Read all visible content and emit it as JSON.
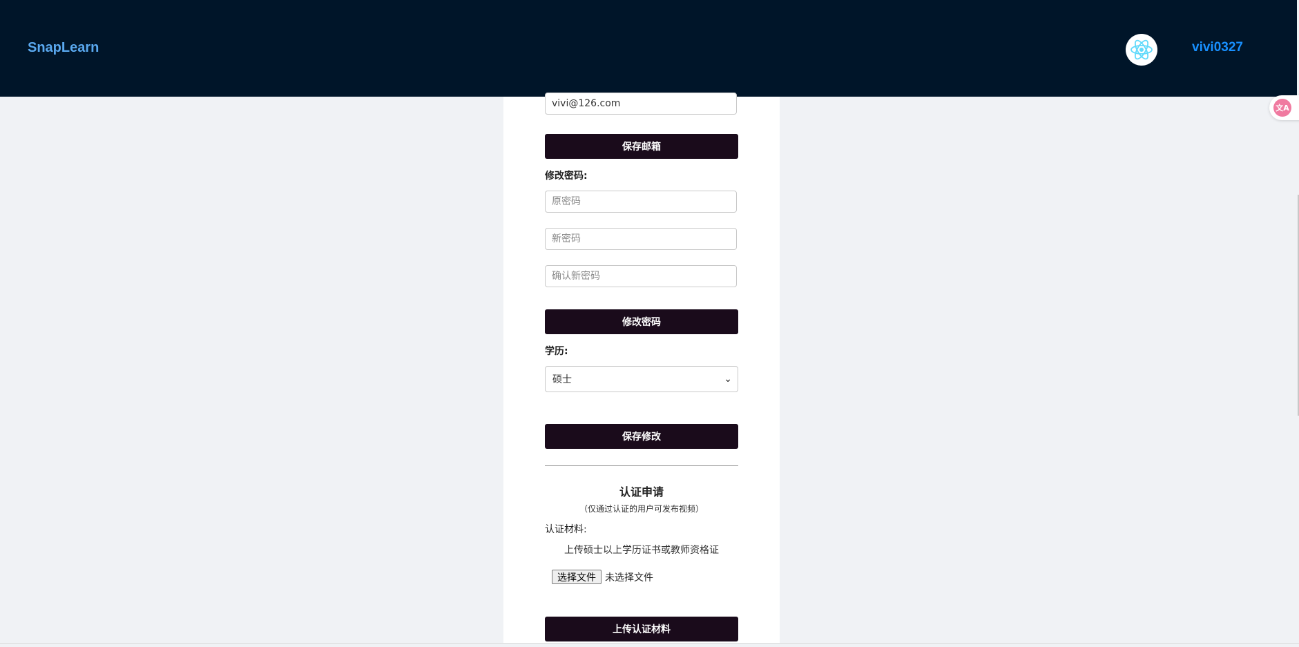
{
  "header": {
    "brand": "SnapLearn",
    "username": "vivi0327",
    "avatar_icon": "react-atom-icon"
  },
  "form": {
    "email_value": "vivi@126.com",
    "save_email_label": "保存邮箱",
    "password_section_label": "修改密码:",
    "old_password_placeholder": "原密码",
    "new_password_placeholder": "新密码",
    "confirm_password_placeholder": "确认新密码",
    "change_password_label": "修改密码",
    "education_label": "学历:",
    "education_selected": "硕士",
    "save_changes_label": "保存修改"
  },
  "certification": {
    "title": "认证申请",
    "note": "（仅通过认证的用户可发布视频）",
    "material_label": "认证材料:",
    "material_hint": "上传硕士以上学历证书或教师资格证",
    "choose_file_label": "选择文件",
    "file_status": "未选择文件",
    "upload_label": "上传认证材料"
  },
  "colors": {
    "header_bg": "#001529",
    "brand": "#5aa9f0",
    "username": "#1890ff",
    "button_bg": "#1a0b1b",
    "page_bg": "#f0f2f5"
  }
}
